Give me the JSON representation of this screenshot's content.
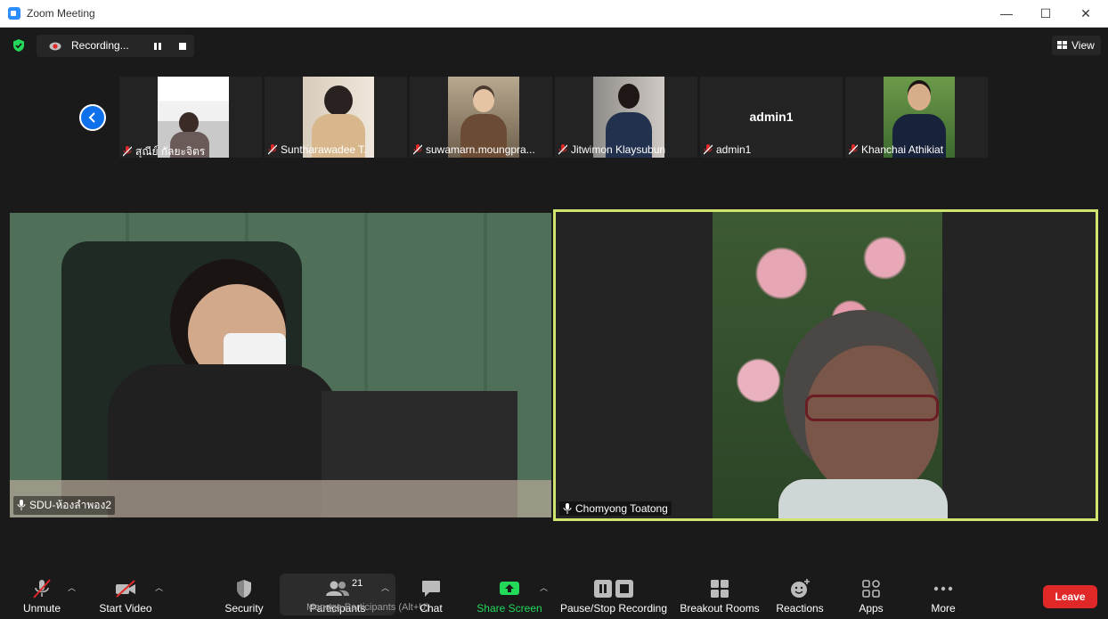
{
  "window": {
    "title": "Zoom Meeting",
    "minimize": "—",
    "maximize": "☐",
    "close": "✕"
  },
  "recording": {
    "status": "Recording..."
  },
  "view": {
    "label": "View"
  },
  "thumbnails": [
    {
      "name": "สุณีย์ กัลยะจิตร",
      "muted": true
    },
    {
      "name": "Suntharawadee T.",
      "muted": true
    },
    {
      "name": "suwamarn.moungpra...",
      "muted": true
    },
    {
      "name": "Jitwimon Klaysubun",
      "muted": true
    },
    {
      "name": "admin1",
      "muted": true,
      "display": "admin1"
    },
    {
      "name": "Khanchai Athikiat",
      "muted": true
    }
  ],
  "main_videos": [
    {
      "name": "SDU-ห้องลำพอง2"
    },
    {
      "name": "Chomyong Toatong"
    }
  ],
  "toolbar": {
    "unmute": "Unmute",
    "start_video": "Start Video",
    "security": "Security",
    "participants": "Participants",
    "participants_count": "21",
    "participants_ghost": "Manage Participants (Alt+U)",
    "chat": "Chat",
    "share_screen": "Share Screen",
    "pause_stop_recording": "Pause/Stop Recording",
    "breakout_rooms": "Breakout Rooms",
    "reactions": "Reactions",
    "apps": "Apps",
    "more": "More",
    "leave": "Leave"
  },
  "colors": {
    "accent": "#0e71eb",
    "leave": "#e02828",
    "share": "#23d959",
    "active_speaker": "#cfe56f",
    "muted_red": "#e02828"
  }
}
